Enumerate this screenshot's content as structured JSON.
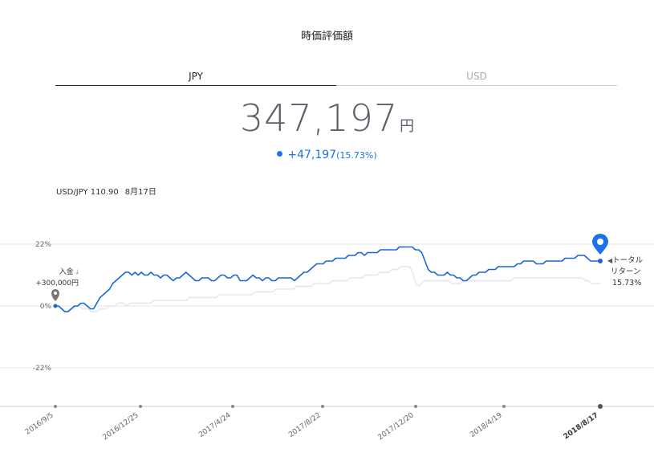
{
  "header": {
    "title": "時価評価額"
  },
  "tabs": [
    {
      "label": "JPY",
      "active": true
    },
    {
      "label": "USD",
      "active": false
    }
  ],
  "summary": {
    "total_value": "347,197",
    "currency_unit": "円",
    "change": "+47,197",
    "change_pct": "(15.73%)",
    "accent_color": "#1a73e8"
  },
  "rate": {
    "pair_text": "USD/JPY 110.90",
    "date_text": "8月17日"
  },
  "deposit": {
    "label": "入金",
    "amount": "+300,000円",
    "icon": "download-icon"
  },
  "return_label": {
    "line1": "トータル",
    "line2": "リターン",
    "value": "15.73%"
  },
  "chart_data": {
    "type": "line",
    "y_tick_labels": [
      "22%",
      "0%",
      "-22%"
    ],
    "ylim": [
      -36,
      36
    ],
    "x_tick_labels": [
      "2016/9/5",
      "2016/12/25",
      "2017/4/24",
      "2017/8/22",
      "2017/12/20",
      "2018/4/19",
      "2018/8/17"
    ],
    "series": [
      {
        "color": "#1a66d6",
        "values": [
          0,
          0,
          -1,
          -2,
          -2,
          -1,
          0,
          0,
          1,
          1,
          0,
          -1,
          -1,
          1,
          3,
          4,
          5,
          6,
          8,
          9,
          10,
          11,
          12,
          12,
          11,
          12,
          11,
          12,
          11,
          11,
          12,
          11,
          11,
          10,
          11,
          11,
          10,
          9,
          10,
          10,
          11,
          12,
          11,
          10,
          9,
          9,
          10,
          10,
          10,
          9,
          9,
          10,
          11,
          11,
          10,
          10,
          11,
          11,
          9,
          9,
          9,
          10,
          11,
          10,
          10,
          9,
          10,
          10,
          9,
          9,
          10,
          10,
          10,
          10,
          10,
          9,
          10,
          11,
          12,
          12,
          13,
          14,
          15,
          15,
          15,
          16,
          16,
          16,
          17,
          17,
          17,
          17,
          18,
          18,
          18,
          19,
          19,
          18,
          19,
          19,
          19,
          19,
          20,
          20,
          20,
          20,
          20,
          20,
          21,
          21,
          21,
          21,
          21,
          20,
          20,
          19,
          16,
          13,
          12,
          12,
          11,
          11,
          11,
          12,
          11,
          11,
          10,
          10,
          9,
          9,
          10,
          11,
          11,
          12,
          12,
          12,
          13,
          13,
          13,
          14,
          14,
          14,
          14,
          14,
          14,
          15,
          15,
          16,
          16,
          16,
          16,
          15,
          15,
          15,
          16,
          16,
          16,
          16,
          16,
          16,
          17,
          17,
          17,
          17,
          18,
          18,
          18,
          17,
          16,
          16,
          16,
          16
        ]
      },
      {
        "color": "#e3e6ef",
        "values": [
          0,
          0,
          -1,
          -2,
          -2,
          -1,
          -1,
          0,
          0,
          -1,
          -1,
          -1,
          -2,
          -2,
          -2,
          -1,
          -1,
          -1,
          0,
          0,
          0,
          1,
          1,
          1,
          0,
          1,
          1,
          1,
          1,
          1,
          1,
          1,
          1,
          2,
          2,
          2,
          2,
          2,
          2,
          2,
          2,
          2,
          2,
          2,
          2,
          3,
          3,
          3,
          3,
          3,
          3,
          3,
          3,
          3,
          3,
          4,
          4,
          4,
          4,
          4,
          4,
          4,
          4,
          4,
          4,
          4,
          4,
          5,
          5,
          5,
          5,
          5,
          5,
          5,
          6,
          6,
          6,
          6,
          6,
          6,
          6,
          7,
          7,
          7,
          7,
          7,
          7,
          8,
          8,
          8,
          8,
          8,
          8,
          9,
          9,
          9,
          9,
          9,
          9,
          10,
          10,
          10,
          10,
          10,
          11,
          11,
          11,
          11,
          11,
          12,
          12,
          12,
          12,
          13,
          13,
          13,
          14,
          14,
          14,
          14,
          12,
          8,
          7,
          8,
          9,
          9,
          9,
          9,
          9,
          9,
          9,
          9,
          9,
          8,
          8,
          8,
          8,
          9,
          9,
          9,
          9,
          9,
          9,
          9,
          9,
          9,
          9,
          9,
          9,
          9,
          9,
          9,
          9,
          9,
          10,
          10,
          10,
          10,
          10,
          10,
          10,
          10,
          10,
          10,
          10,
          10,
          10,
          10,
          10,
          10,
          10,
          10,
          10,
          10,
          10,
          10,
          10,
          10,
          9,
          9,
          8,
          8,
          8,
          8
        ]
      }
    ]
  }
}
